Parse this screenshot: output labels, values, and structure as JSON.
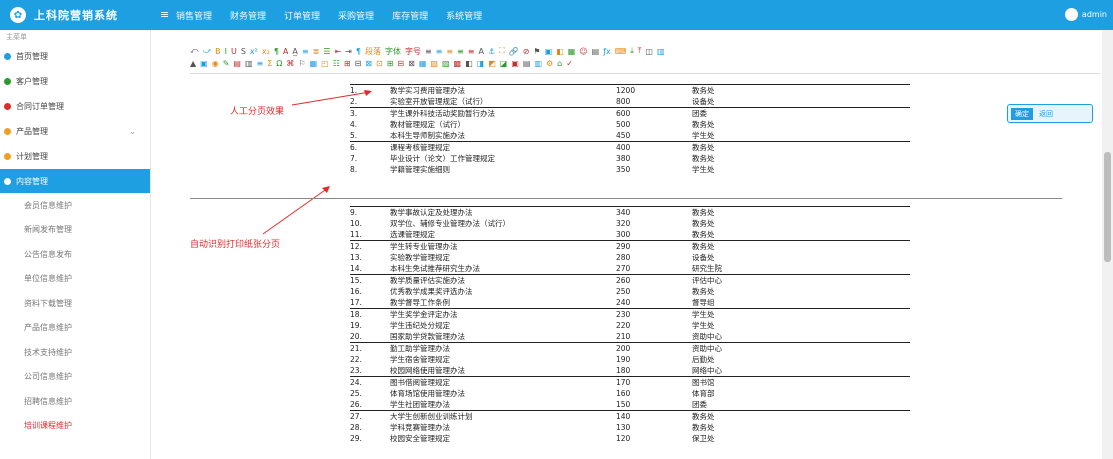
{
  "header": {
    "logo": "✿",
    "title": "上科院营销系统",
    "menu_toggle": "≡",
    "nav": [
      "销售管理",
      "财务管理",
      "订单管理",
      "采购管理",
      "库存管理",
      "系统管理"
    ],
    "user": "admin"
  },
  "sidebar": {
    "heading": "主菜单",
    "items": [
      {
        "label": "首页管理",
        "color": "#1e9fe2"
      },
      {
        "label": "客户管理",
        "color": "#2c9a2c"
      },
      {
        "label": "合同订单管理",
        "color": "#e02b2b"
      },
      {
        "label": "产品管理",
        "color": "#f0a020"
      },
      {
        "label": "计划管理",
        "color": "#f0a020"
      }
    ],
    "active": {
      "label": "内容管理",
      "color": "#ffffff"
    },
    "subitems": [
      "会员信息维护",
      "新闻发布管理",
      "公告信息发布",
      "单位信息维护",
      "资料下载管理",
      "产品信息维护",
      "技术支持维护",
      "公司信息维护",
      "招聘信息维护",
      "培训课程维护"
    ],
    "selected_index": 9
  },
  "toolbar": {
    "row1": [
      "⤺",
      "⤻",
      "B",
      "I",
      "U",
      "S",
      "x²",
      "x₂",
      "¶",
      "A",
      "A̲",
      "≡",
      "≣",
      "☰",
      "⇤",
      "⇥",
      "¶",
      "段落",
      "字体",
      "字号",
      "≡",
      "≡",
      "≡",
      "≡",
      "≡",
      "A",
      "⚓",
      "⛶",
      "🔗",
      "⊘",
      "⚑",
      "▣",
      "◧",
      "▦",
      "☺",
      "▤",
      "ƒx",
      "⌨",
      "⤓",
      "⤒",
      "◫",
      "▥"
    ],
    "row2": [
      "▲",
      "▣",
      "◉",
      "✎",
      "▤",
      "▥",
      "≡",
      "Σ",
      "Ω",
      "⌘",
      "⚐",
      "▦",
      "◰",
      "☷",
      "⊞",
      "⊟",
      "⊠",
      "⊡",
      "⊞",
      "⊟",
      "⊠",
      "▦",
      "▧",
      "▨",
      "▩",
      "◧",
      "◨",
      "◩",
      "◪",
      "▣",
      "▤",
      "▥",
      "⚙",
      "⌂",
      "✓"
    ]
  },
  "document": {
    "annotation_top": "人工分页效果",
    "annotation_bottom": "自动识别打印纸张分页",
    "rows_top": [
      [
        "1.",
        "教学实习费用管理办法",
        "1200",
        "教务处"
      ],
      [
        "2.",
        "实验室开放管理规定（试行）",
        "800",
        "设备处"
      ],
      [
        "3.",
        "学生课外科技活动奖励暂行办法",
        "600",
        "团委"
      ],
      [
        "4.",
        "教材管理规定（试行）",
        "500",
        "教务处"
      ],
      [
        "5.",
        "本科生导师制实施办法",
        "450",
        "学生处"
      ],
      [
        "6.",
        "课程考核管理规定",
        "400",
        "教务处"
      ],
      [
        "7.",
        "毕业设计（论文）工作管理规定",
        "380",
        "教务处"
      ],
      [
        "8.",
        "学籍管理实施细则",
        "350",
        "学生处"
      ]
    ],
    "rows_bottom": [
      [
        "9.",
        "教学事故认定及处理办法",
        "340",
        "教务处"
      ],
      [
        "10.",
        "双学位、辅修专业管理办法（试行）",
        "320",
        "教务处"
      ],
      [
        "11.",
        "选课管理规定",
        "300",
        "教务处"
      ],
      [
        "12.",
        "学生转专业管理办法",
        "290",
        "教务处"
      ],
      [
        "13.",
        "实验教学管理规定",
        "280",
        "设备处"
      ],
      [
        "14.",
        "本科生免试推荐研究生办法",
        "270",
        "研究生院"
      ],
      [
        "15.",
        "教学质量评估实施办法",
        "260",
        "评估中心"
      ],
      [
        "16.",
        "优秀教学成果奖评选办法",
        "250",
        "教务处"
      ],
      [
        "17.",
        "教学督导工作条例",
        "240",
        "督导组"
      ],
      [
        "18.",
        "学生奖学金评定办法",
        "230",
        "学生处"
      ],
      [
        "19.",
        "学生违纪处分规定",
        "220",
        "学生处"
      ],
      [
        "20.",
        "国家助学贷款管理办法",
        "210",
        "资助中心"
      ],
      [
        "21.",
        "勤工助学管理办法",
        "200",
        "资助中心"
      ],
      [
        "22.",
        "学生宿舍管理规定",
        "190",
        "后勤处"
      ],
      [
        "23.",
        "校园网络使用管理办法",
        "180",
        "网络中心"
      ],
      [
        "24.",
        "图书借阅管理规定",
        "170",
        "图书馆"
      ],
      [
        "25.",
        "体育场馆使用管理办法",
        "160",
        "体育部"
      ],
      [
        "26.",
        "学生社团管理办法",
        "150",
        "团委"
      ],
      [
        "27.",
        "大学生创新创业训练计划",
        "140",
        "教务处"
      ],
      [
        "28.",
        "学科竞赛管理办法",
        "130",
        "教务处"
      ],
      [
        "29.",
        "校园安全管理规定",
        "120",
        "保卫处"
      ]
    ]
  },
  "side_button": {
    "primary": "确定",
    "secondary": "返回"
  }
}
